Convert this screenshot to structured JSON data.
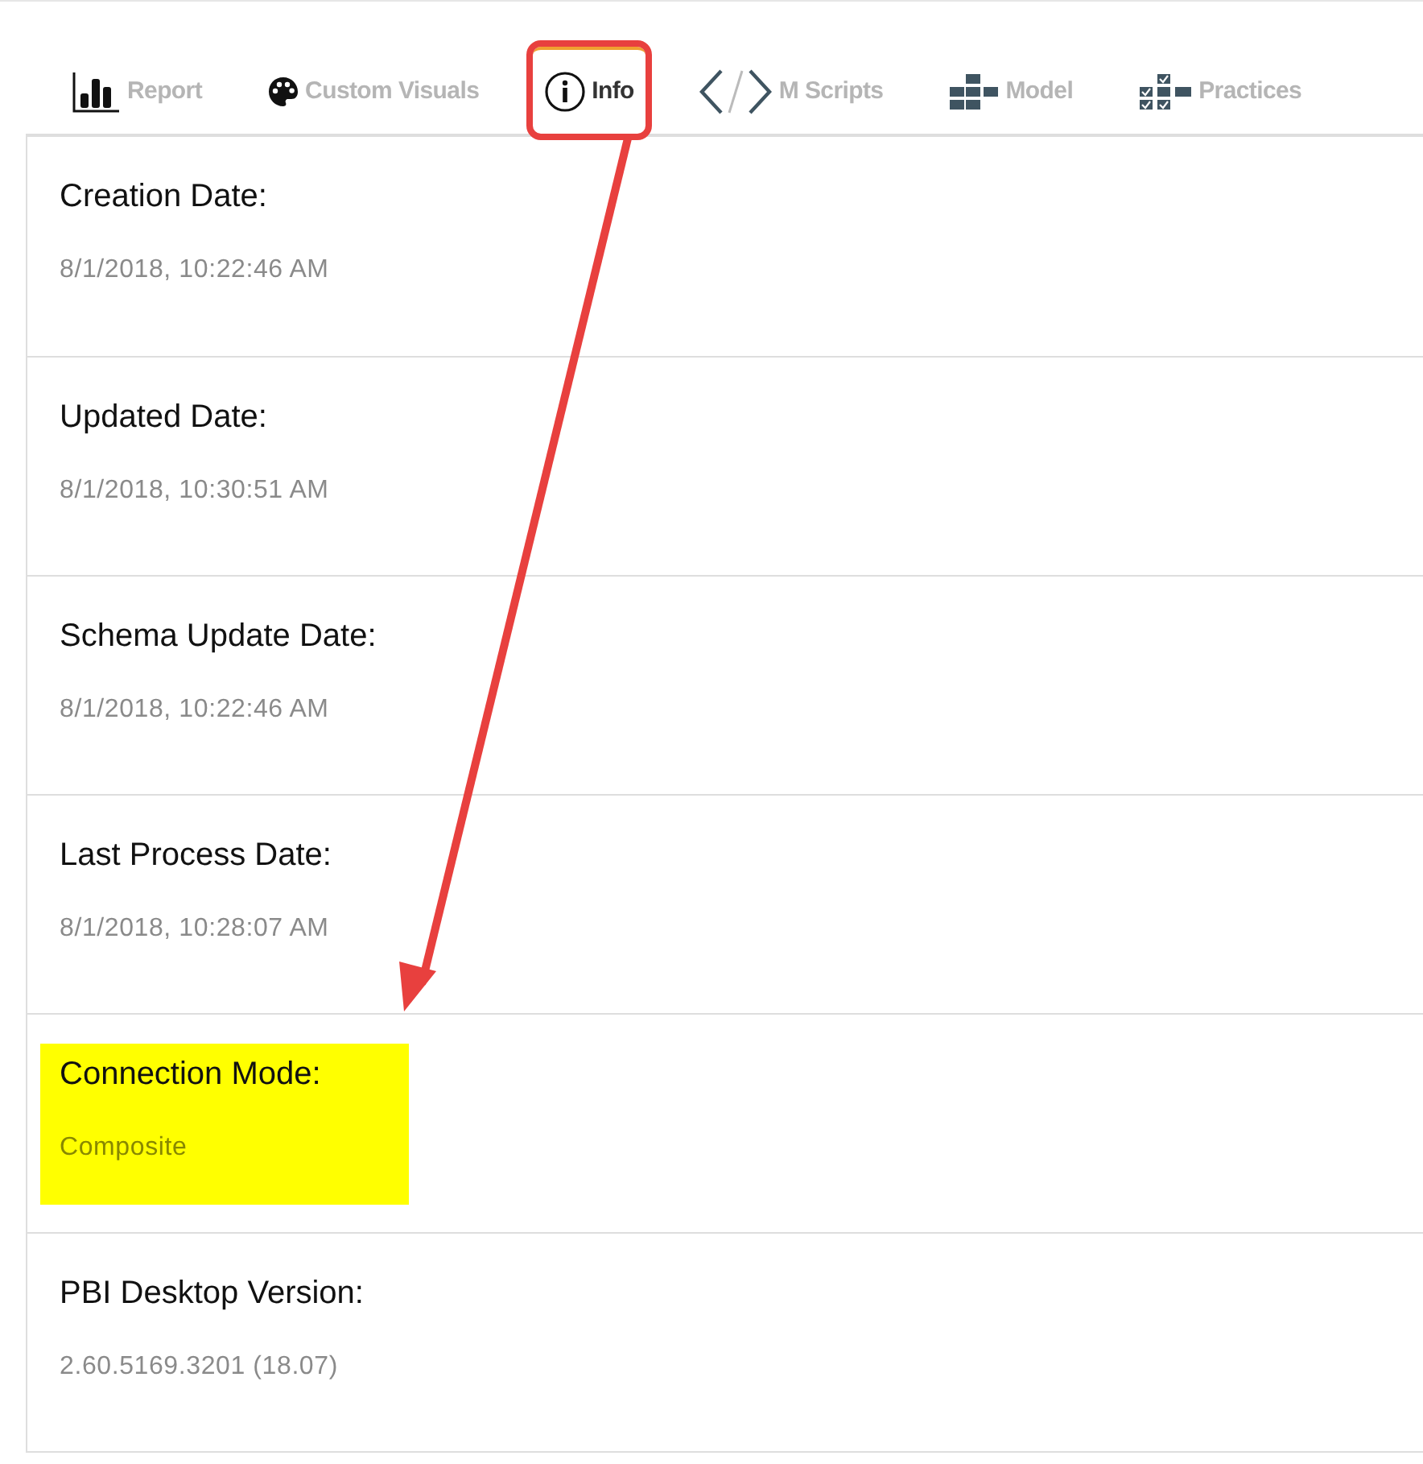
{
  "tabs": [
    {
      "label": "Report",
      "selected": false,
      "annotated": false
    },
    {
      "label": "Custom Visuals",
      "selected": false,
      "annotated": false
    },
    {
      "label": "Info",
      "selected": true,
      "annotated": true
    },
    {
      "label": "M Scripts",
      "selected": false,
      "annotated": false
    },
    {
      "label": "Model",
      "selected": false,
      "annotated": false
    },
    {
      "label": "Practices",
      "selected": false,
      "annotated": false
    }
  ],
  "fields": [
    {
      "label": "Creation Date:",
      "value": "8/1/2018, 10:22:46 AM",
      "highlighted": false
    },
    {
      "label": "Updated Date:",
      "value": "8/1/2018, 10:30:51 AM",
      "highlighted": false
    },
    {
      "label": "Schema Update Date:",
      "value": "8/1/2018, 10:22:46 AM",
      "highlighted": false
    },
    {
      "label": "Last Process Date:",
      "value": "8/1/2018, 10:28:07 AM",
      "highlighted": false
    },
    {
      "label": "Connection Mode:",
      "value": "Composite",
      "highlighted": true
    },
    {
      "label": "PBI Desktop Version:",
      "value": "2.60.5169.3201 (18.07)",
      "highlighted": false
    }
  ]
}
